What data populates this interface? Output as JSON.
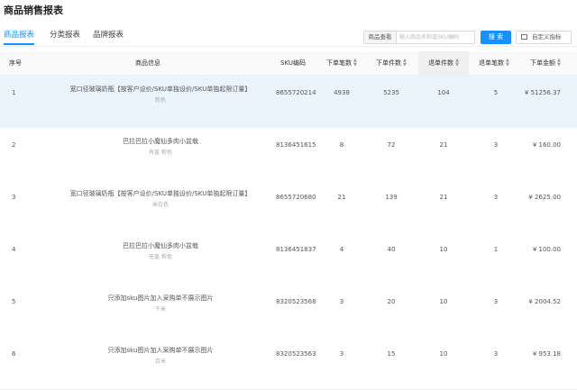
{
  "page": {
    "title": "商品销售报表"
  },
  "tabs": [
    {
      "label": "商品报表",
      "active": true
    },
    {
      "label": "分类报表",
      "active": false
    },
    {
      "label": "品牌报表",
      "active": false
    }
  ],
  "search": {
    "label": "商品查看",
    "placeholder": "输入商品名称或SKU编码",
    "value": ""
  },
  "buttons": {
    "search_label": "搜 索",
    "custom_label": "自定义指标",
    "custom_icon": "columns-icon"
  },
  "colors": {
    "accent": "#1890ff",
    "highlight_row": "#eaf4fc"
  },
  "table": {
    "columns": [
      {
        "key": "index",
        "label": "序号",
        "sortable": false
      },
      {
        "key": "info",
        "label": "商品信息",
        "sortable": false
      },
      {
        "key": "sku",
        "label": "SKU编码",
        "sortable": false
      },
      {
        "key": "orders",
        "label": "下单笔数",
        "sortable": true
      },
      {
        "key": "pieces",
        "label": "下单件数",
        "sortable": true
      },
      {
        "key": "refund_pieces",
        "label": "退单件数",
        "sortable": true,
        "sorted": true
      },
      {
        "key": "refund_orders",
        "label": "退单笔数",
        "sortable": true
      },
      {
        "key": "amount",
        "label": "下单金额",
        "sortable": true
      }
    ],
    "rows": [
      {
        "index": "1",
        "name": "宽口径玻璃奶瓶【按客户设价/SKU单独设价/SKU单独起限订量】",
        "spec": "粉色",
        "sku": "8655720214",
        "orders": "4938",
        "pieces": "5235",
        "refund_pieces": "104",
        "refund_orders": "5",
        "amount": "¥ 51256.37",
        "highlight": true
      },
      {
        "index": "2",
        "name": "巴拉巴拉小魔仙多肉小盆栽",
        "spec": "有盖 粉色",
        "sku": "8136451615",
        "orders": "8",
        "pieces": "72",
        "refund_pieces": "21",
        "refund_orders": "3",
        "amount": "¥ 160.00",
        "highlight": false
      },
      {
        "index": "3",
        "name": "宽口径玻璃奶瓶【按客户设价/SKU单独设价/SKU单独起限订量】",
        "spec": "米白色",
        "sku": "8655720680",
        "orders": "21",
        "pieces": "139",
        "refund_pieces": "21",
        "refund_orders": "3",
        "amount": "¥ 2625.00",
        "highlight": false
      },
      {
        "index": "4",
        "name": "巴拉巴拉小魔仙多肉小盆栽",
        "spec": "无盖 粉色",
        "sku": "8136451837",
        "orders": "4",
        "pieces": "40",
        "refund_pieces": "10",
        "refund_orders": "1",
        "amount": "¥ 100.00",
        "highlight": false
      },
      {
        "index": "5",
        "name": "只添加sku图片加入采购单不展示图片",
        "spec": "千米",
        "sku": "8320523568",
        "orders": "3",
        "pieces": "20",
        "refund_pieces": "10",
        "refund_orders": "3",
        "amount": "¥ 2004.52",
        "highlight": false
      },
      {
        "index": "6",
        "name": "只添加sku图片加入采购单不展示图片",
        "spec": "百米",
        "sku": "8320523563",
        "orders": "3",
        "pieces": "15",
        "refund_pieces": "10",
        "refund_orders": "3",
        "amount": "¥ 953.18",
        "highlight": false
      }
    ]
  }
}
